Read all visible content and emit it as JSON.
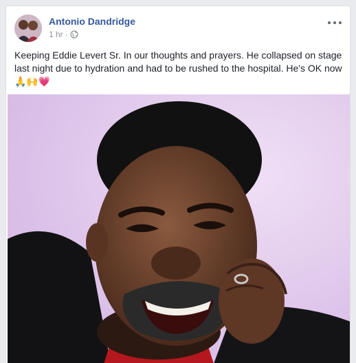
{
  "post": {
    "author": "Antonio Dandridge",
    "time": "1 hr",
    "separator": "·",
    "audience_icon": "globe-icon",
    "text": "Keeping Eddie Levert Sr. In our thoughts and prayers. He collapsed on stage last night due to hydration and had to be rushed to the hospital. He's OK now 🙏🙌💗",
    "menu_icon": "more-options-icon"
  },
  "colors": {
    "author_link": "#365899",
    "meta_text": "#90949c",
    "photo_background": "#dcc1e9"
  }
}
